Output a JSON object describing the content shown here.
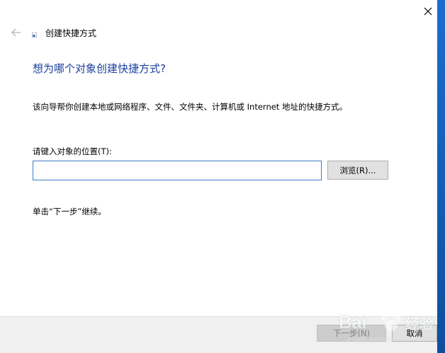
{
  "window": {
    "title": "创建快捷方式",
    "close_icon": "close-icon",
    "back_icon": "back-arrow-icon"
  },
  "main": {
    "heading": "想为哪个对象创建快捷方式?",
    "description": "该向导帮你创建本地或网络程序、文件、文件夹、计算机或 Internet 地址的快捷方式。",
    "location_label": "请键入对象的位置(T):",
    "location_value": "",
    "browse_label": "浏览(R)...",
    "hint": "单击“下一步”继续。"
  },
  "footer": {
    "next_label": "下一步(N)",
    "cancel_label": "取消"
  },
  "watermark": {
    "brand": "Bai",
    "suffix": "经验",
    "domain": "jingyan.baidu.com"
  },
  "colors": {
    "heading": "#1a3e9c",
    "input_border": "#3b7fc4",
    "desktop": "#1b6dd0",
    "footer": "#f0f0f0"
  }
}
